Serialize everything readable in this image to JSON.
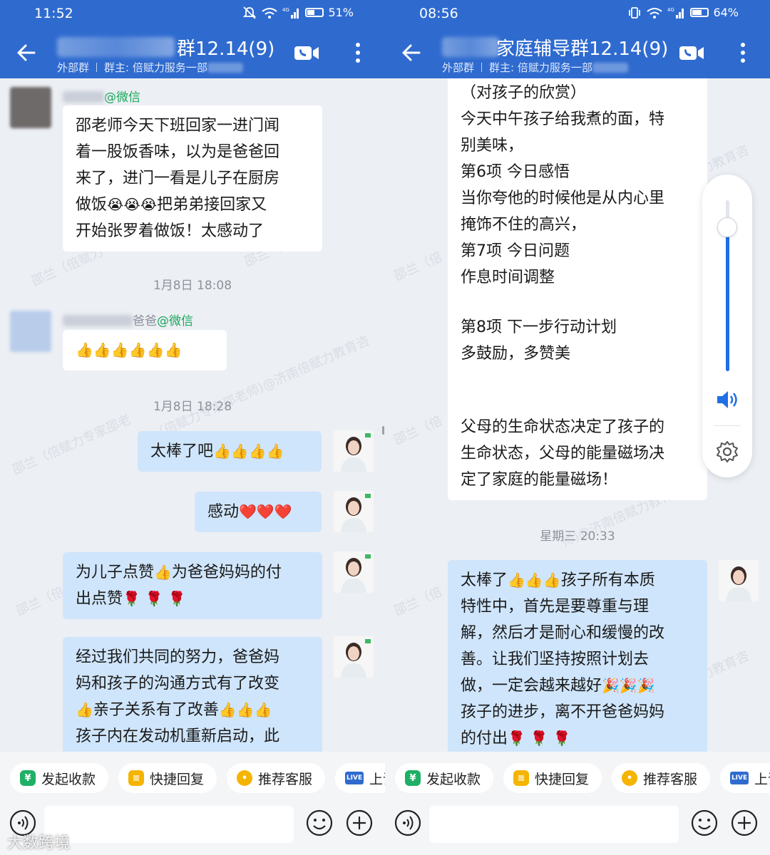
{
  "left": {
    "status": {
      "time": "11:52",
      "battery": "51%",
      "battery_level": 0.51
    },
    "header": {
      "title_suffix": "群12.14(9)",
      "external_label": "外部群",
      "owner_label": "群主: 倍赋力服务一部"
    },
    "messages": {
      "m1": {
        "sender_suffix": "@微信",
        "lines": [
          "邵老师今天下班回家一进门闻",
          "着一股饭香味，以为是爸爸回",
          "来了，进门一看是儿子在厨房",
          "做饭",
          "把弟弟接回家又",
          "开始张罗着做饭！太感动了"
        ],
        "emoji": "😭"
      },
      "t1": "1月8日  18:08",
      "m2": {
        "sender_name": "爸爸",
        "sender_suffix": "@微信",
        "emoji": "👍"
      },
      "t2": "1月8日  18:28",
      "m3": {
        "text": "太棒了吧",
        "emoji": "👍"
      },
      "m4": {
        "text": "感动",
        "emoji": "❤️"
      },
      "m5": {
        "lines": [
          "为儿子点赞",
          "为爸爸妈妈的付",
          "出点赞"
        ],
        "emoji_thumb": "👍",
        "emoji_rose": "🌹"
      },
      "m6": {
        "lines": [
          "经过我们共同的努力，爸爸妈",
          "妈和孩子的沟通方式有了改变",
          "亲子关系有了改善",
          "孩子内在发动机重新启动，此"
        ],
        "emoji": "👍"
      }
    },
    "toolbar": {
      "chips": [
        "发起收款",
        "快捷回复",
        "推荐客服",
        "上课"
      ],
      "live_badge": "LIVE"
    },
    "brand": "大数跨境"
  },
  "right": {
    "status": {
      "time": "08:56",
      "battery": "64%",
      "battery_level": 0.64
    },
    "header": {
      "title_suffix": "家庭辅导群12.14(9)",
      "external_label": "外部群",
      "owner_label": "群主: 倍赋力服务一部"
    },
    "messages": {
      "m1": {
        "lines": [
          "（对孩子的欣赏）",
          " 今天中午孩子给我煮的面，特",
          "别美味，",
          "第6项    今日感悟",
          "当你夸他的时候他是从内心里",
          "掩饰不住的高兴，",
          "第7项    今日问题",
          "作息时间调整",
          "",
          "第8项    下一步行动计划",
          "多鼓励，多赞美",
          "",
          "",
          "父母的生命状态决定了孩子的",
          "生命状态，父母的能量磁场决",
          "定了家庭的能量磁场！"
        ]
      },
      "t1": "星期三  20:33",
      "m2": {
        "lines": [
          "太棒了",
          "孩子所有本质",
          "特性中，首先是要尊重与理",
          "解，然后才是耐心和缓慢的改",
          "善。让我们坚持按照计划去",
          "做，一定会越来越好",
          "孩子的进步，离不开爸爸妈妈",
          "的付出"
        ],
        "emoji_thumb": "👍",
        "emoji_party": "🎉",
        "emoji_rose": "🌹"
      }
    },
    "volume": {
      "level": 0.84
    },
    "toolbar": {
      "chips": [
        "发起收款",
        "快捷回复",
        "推荐客服",
        "上课"
      ],
      "live_badge": "LIVE"
    }
  },
  "colors": {
    "header_blue": "#2f6bcf",
    "bubble_blue": "#cfe5fb",
    "tag_green": "#19a85a",
    "slider_blue": "#1f6fe5"
  },
  "icons": [
    "back-arrow-icon",
    "video-call-icon",
    "more-vertical-icon",
    "mute-icon",
    "wifi-icon",
    "signal-icon",
    "battery-icon",
    "vibrate-icon",
    "speaker-icon",
    "gear-icon",
    "voice-icon",
    "emoji-icon",
    "plus-icon",
    "yuan-icon",
    "quick-reply-icon",
    "service-icon",
    "live-icon"
  ]
}
